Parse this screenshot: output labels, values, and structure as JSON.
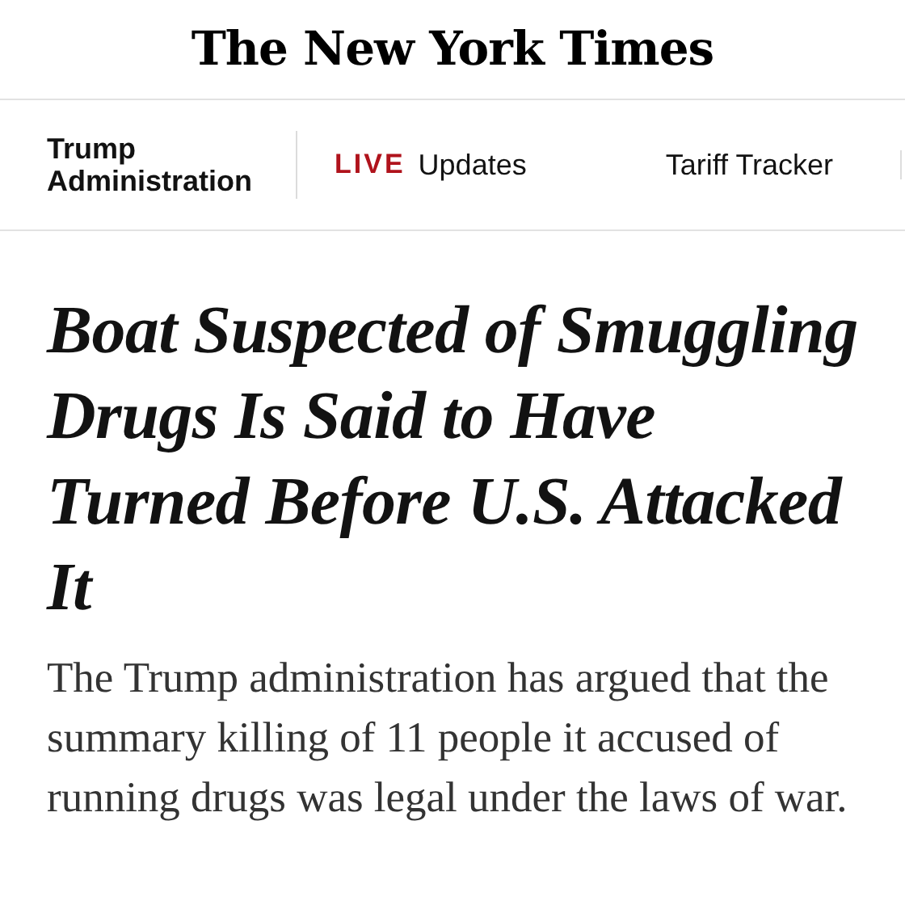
{
  "masthead": {
    "logo": "The New York Times"
  },
  "section_nav": {
    "section": "Trump Administration",
    "links": [
      {
        "live_label": "LIVE",
        "label": "Updates"
      },
      {
        "label": "Tariff Tracker"
      }
    ]
  },
  "article": {
    "headline": "Boat Suspected of Smuggling Drugs Is Said to Have Turned Before U.S. Attacked It",
    "summary": "The Trump administration has argued that the summary killing of 11 people it accused of running drugs was legal under the laws of war."
  }
}
